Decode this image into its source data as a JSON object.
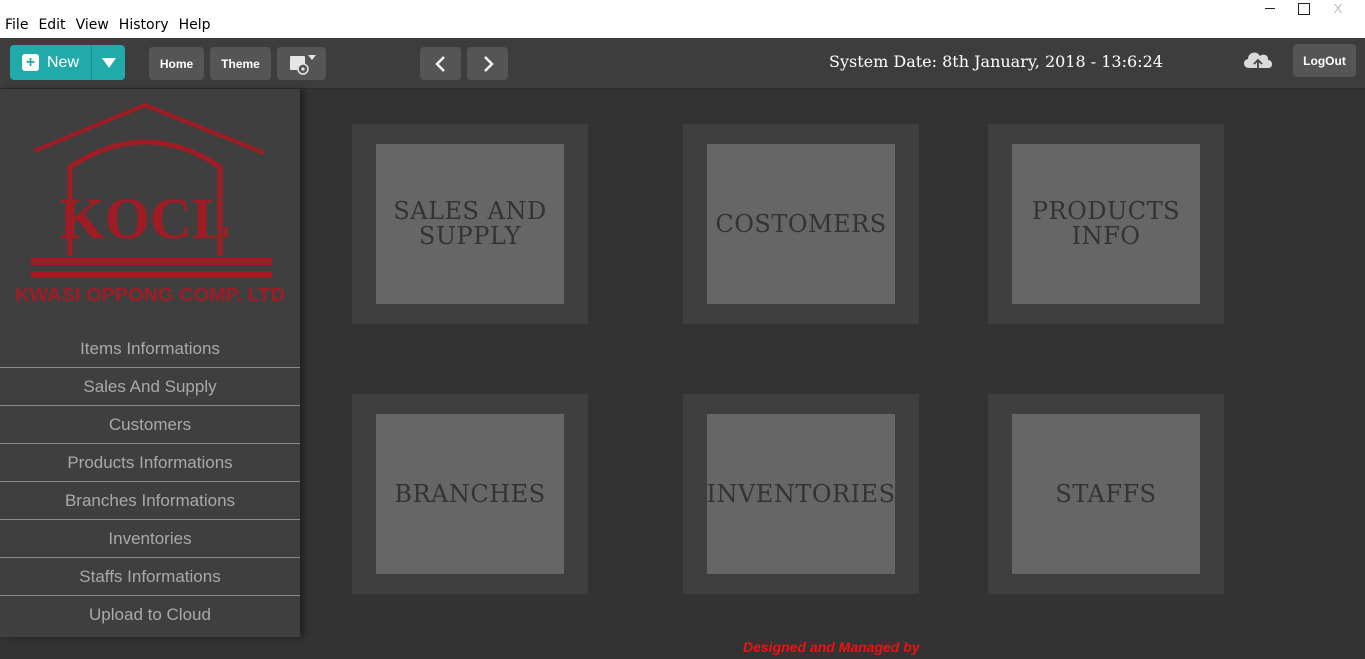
{
  "menu": [
    "File",
    "Edit",
    "View",
    "History",
    "Help"
  ],
  "window": {
    "close_label": "X"
  },
  "toolbar": {
    "new_label": "New",
    "plus_glyph": "+",
    "home_label": "Home",
    "theme_label": "Theme",
    "logout_label": "LogOut",
    "system_date": "System Date: 8th January, 2018 - 13:6:24"
  },
  "sidebar": {
    "logo_text": "KOCL",
    "logo_subtitle": "KWASI OPPONG COMP. LTD",
    "items": [
      "Items Informations",
      "Sales And Supply",
      "Customers",
      "Products Informations",
      "Branches Informations",
      "Inventories",
      "Staffs Informations",
      "Upload to Cloud"
    ]
  },
  "tiles": [
    {
      "line1": "SALES AND",
      "line2": "SUPPLY"
    },
    {
      "line1": "COSTOMERS",
      "line2": ""
    },
    {
      "line1": "PRODUCTS",
      "line2": "INFO"
    },
    {
      "line1": "BRANCHES",
      "line2": ""
    },
    {
      "line1": "INVENTORIES",
      "line2": ""
    },
    {
      "line1": "STAFFS",
      "line2": ""
    }
  ],
  "footer": {
    "text": "Designed and Managed by"
  },
  "colors": {
    "accent": "#20aaaa",
    "toolbar": "#3d3d3d",
    "background": "#333333",
    "tile": "#666666",
    "logo_red": "#a01c24",
    "footer_red": "#ee1111"
  }
}
